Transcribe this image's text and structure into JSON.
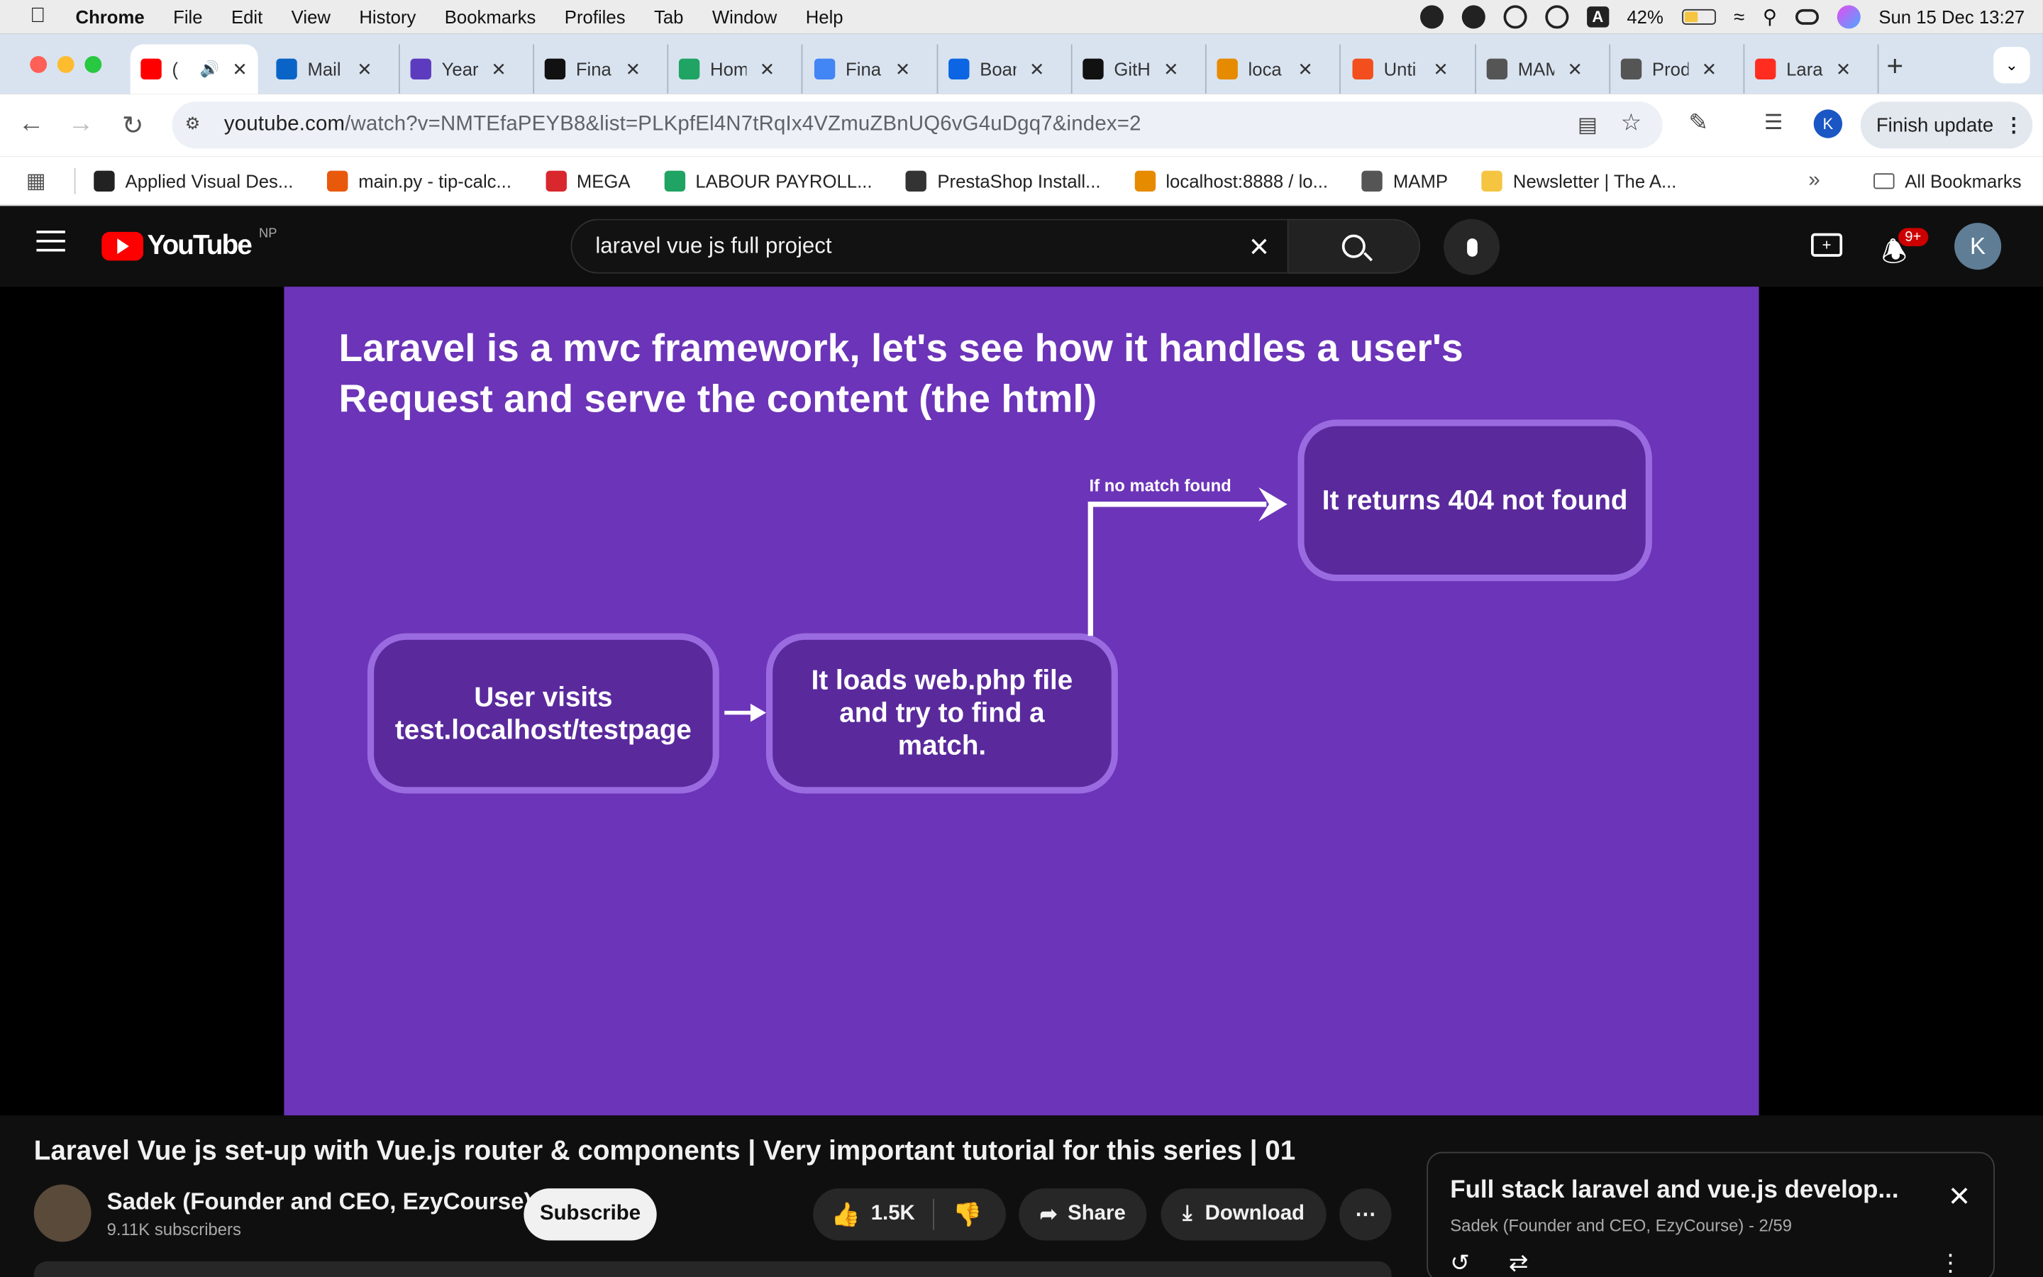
{
  "menubar": {
    "app": "Chrome",
    "items": [
      "File",
      "Edit",
      "View",
      "History",
      "Bookmarks",
      "Profiles",
      "Tab",
      "Window",
      "Help"
    ],
    "battery": "42%",
    "input_source": "A",
    "datetime": "Sun 15 Dec  13:27"
  },
  "tabs": [
    {
      "label": "(",
      "color": "#ff0000"
    },
    {
      "label": "Mail",
      "color": "#0a64c8"
    },
    {
      "label": "Year",
      "color": "#5c3bbf"
    },
    {
      "label": "Fina",
      "color": "#111111"
    },
    {
      "label": "Hom",
      "color": "#1fa463"
    },
    {
      "label": "Fina",
      "color": "#4285f4"
    },
    {
      "label": "Boar",
      "color": "#0c66e4"
    },
    {
      "label": "GitH",
      "color": "#111111"
    },
    {
      "label": "loca",
      "color": "#e68a00"
    },
    {
      "label": "Unti",
      "color": "#f24e1e"
    },
    {
      "label": "MAM",
      "color": "#555555"
    },
    {
      "label": "Prod",
      "color": "#555555"
    },
    {
      "label": "Lara",
      "color": "#ff2d20"
    }
  ],
  "toolbar": {
    "url_host": "youtube.com",
    "url_path": "/watch?v=NMTEfaPEYB8&list=PLKpfEl4N7tRqIx4VZmuZBnUQ6vG4uDgq7&index=2",
    "profile_initial": "K",
    "finish_update": "Finish update"
  },
  "bookmarks": {
    "items": [
      {
        "label": "Applied Visual Des...",
        "color": "#222"
      },
      {
        "label": "main.py - tip-calc...",
        "color": "#e8590c"
      },
      {
        "label": "MEGA",
        "color": "#d9272e"
      },
      {
        "label": "LABOUR PAYROLL...",
        "color": "#1fa463"
      },
      {
        "label": "PrestaShop Install...",
        "color": "#333"
      },
      {
        "label": "localhost:8888 / lo...",
        "color": "#e68a00"
      },
      {
        "label": "MAMP",
        "color": "#555"
      },
      {
        "label": "Newsletter | The A...",
        "color": "#f5c542"
      }
    ],
    "all": "All Bookmarks"
  },
  "youtube": {
    "logo_text": "YouTube",
    "region": "NP",
    "search_value": "laravel vue js full project",
    "notifications": "9+",
    "avatar_initial": "K"
  },
  "slide": {
    "title_line1": "Laravel is a mvc framework, let's see how it handles a user's",
    "title_line2": "Request and serve the content (the html)",
    "box1_line1": "User visits",
    "box1_line2": "test.localhost/testpage",
    "box2_line1": "It loads web.php file",
    "box2_line2": "and try to find a",
    "box2_line3": "match.",
    "box3": "It returns 404 not found",
    "arrow_label": "If no match found"
  },
  "video": {
    "title": "Laravel Vue js set-up with Vue.js router & components | Very important tutorial for this series | 01",
    "channel": "Sadek (Founder and CEO, EzyCourse)",
    "subscribers": "9.11K subscribers",
    "subscribe": "Subscribe",
    "likes": "1.5K",
    "share": "Share",
    "download": "Download"
  },
  "playlist": {
    "title": "Full stack laravel and vue.js develop...",
    "channel": "Sadek (Founder and CEO, EzyCourse)",
    "position": " - 2/59"
  }
}
